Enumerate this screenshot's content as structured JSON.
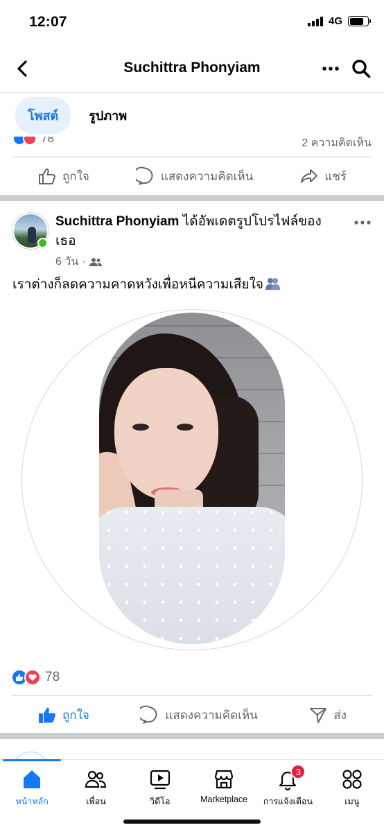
{
  "status_bar": {
    "time": "12:07",
    "network": "4G"
  },
  "header": {
    "title": "Suchittra Phonyiam"
  },
  "tabs": [
    {
      "label": "โพสต์",
      "active": true
    },
    {
      "label": "รูปภาพ",
      "active": false
    }
  ],
  "previous_post": {
    "reaction_count": "78",
    "comments_text": "2 ความคิดเห็น"
  },
  "actions": {
    "like": "ถูกใจ",
    "comment": "แสดงความคิดเห็น",
    "share": "แชร์",
    "send": "ส่ง"
  },
  "post": {
    "author": "Suchittra Phonyiam",
    "action_text": "ได้อัพเดตรูปโปรไฟล์ของเธอ",
    "time": "6 วัน",
    "separator": "·",
    "audience_icon": "friends-icon",
    "text": "เราต่างก็ลดความคาดหวังเพื่อหนีความเสียใจ",
    "reaction_count": "78",
    "liked": true
  },
  "bottom_nav": [
    {
      "label": "หน้าหลัก",
      "icon": "home-icon",
      "active": true
    },
    {
      "label": "เพื่อน",
      "icon": "friends-icon",
      "active": false
    },
    {
      "label": "วิดีโอ",
      "icon": "video-icon",
      "active": false
    },
    {
      "label": "Marketplace",
      "icon": "marketplace-icon",
      "active": false
    },
    {
      "label": "การแจ้งเตือน",
      "icon": "bell-icon",
      "active": false,
      "badge": "3"
    },
    {
      "label": "เมนู",
      "icon": "menu-icon",
      "active": false
    }
  ],
  "colors": {
    "accent": "#1877f2",
    "love": "#f33e58",
    "online": "#42b72a",
    "badge": "#e41e3f"
  }
}
